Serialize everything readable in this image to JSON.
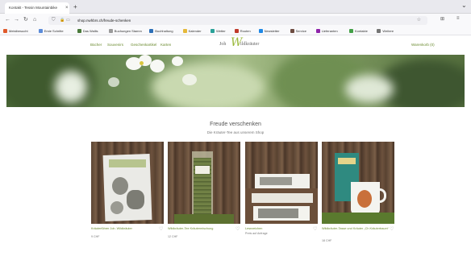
{
  "browser": {
    "tab_title": "Kontakt - Tessin Mountainbike ",
    "tab_close": "×",
    "new_tab": "+",
    "menu_glyph": "⌄",
    "nav": {
      "back": "←",
      "forward": "→",
      "reload": "↻",
      "home": "⌂"
    },
    "url": "shop.nwhbrs.ch/freude-schenken",
    "shield_icon": "shield-icon",
    "extensions": "⊞",
    "menu_button": "≡"
  },
  "bookmarks": [
    {
      "label": "Meistbesucht",
      "color": "#e05a2b"
    },
    {
      "label": "Erste Schritte",
      "color": "#5b8bd9"
    },
    {
      "label": "Das Wallis",
      "color": "#4a7a3b"
    },
    {
      "label": "Buchungen Stamm",
      "color": "#9a9a9a"
    },
    {
      "label": "Buchhaltung",
      "color": "#2c6fb7"
    },
    {
      "label": "Kalender",
      "color": "#e5b93a"
    },
    {
      "label": "Wetter",
      "color": "#2aa198"
    },
    {
      "label": "Routen",
      "color": "#c0392b"
    },
    {
      "label": "Newsletter",
      "color": "#1e88e5"
    },
    {
      "label": "Service",
      "color": "#6d4c41"
    },
    {
      "label": "Lieferanten",
      "color": "#8e24aa"
    },
    {
      "label": "Kontakte",
      "color": "#43a047"
    },
    {
      "label": "Weitere",
      "color": "#757575"
    }
  ],
  "site": {
    "menu": [
      "Bücher",
      "Souvenirs",
      "Geschenkartikel",
      "Karten"
    ],
    "logo_prefix": "Joh",
    "logo_mark": "W",
    "logo_suffix": "ildkräuter",
    "cart": "Warenkorb (0)"
  },
  "section": {
    "title": "Freude verschenken",
    "subtitle": "Die Kräuter-Tee aus unserem Shop"
  },
  "products": [
    {
      "title": "Kräuterführer Joh. Wildkräuter",
      "price": "9 CHF"
    },
    {
      "title": "Wildkräuter-Tee Kräutermischung",
      "price": "12 CHF"
    },
    {
      "title": "Lesezeichen",
      "price": "Preis auf Anfrage"
    },
    {
      "title": "Wildkräuter-Tasse und Kräuter „Ch Kräutertraum“",
      "price": "18 CHF"
    }
  ],
  "icons": {
    "heart": "♡"
  }
}
